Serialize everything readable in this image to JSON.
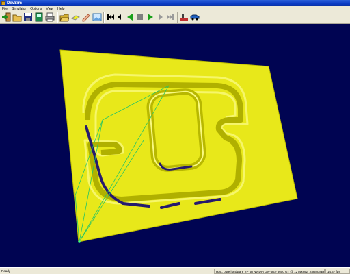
{
  "window": {
    "title": "DevSim"
  },
  "menu": [
    "File",
    "Simulator",
    "Options",
    "View",
    "Help"
  ],
  "toolbar": {
    "icons": [
      "exit-icon",
      "open-icon",
      "save-icon",
      "save-as-icon",
      "print-icon",
      "open-folder-icon",
      "yellow-block-icon",
      "pencil-icon",
      "image-icon",
      "skip-to-start-icon",
      "step-back-icon",
      "play-reverse-icon",
      "stop-icon",
      "play-icon",
      "step-forward-icon",
      "skip-to-end-icon",
      "machine-tool-icon",
      "vehicle-icon"
    ]
  },
  "status": {
    "left": "Ready",
    "renderer": "HAL: pure hardware VP on NVIDIA GeForce 8600 GT @ 1274x892, X8R8G8B8 (D16)",
    "fps": "14.47 fps"
  },
  "colors": {
    "viewport_bg": "#000452",
    "stock_surface": "#e6e619",
    "groove_floor": "#261a6e",
    "toolpath": "#22c466",
    "title_bar": "#0b3cc4"
  }
}
